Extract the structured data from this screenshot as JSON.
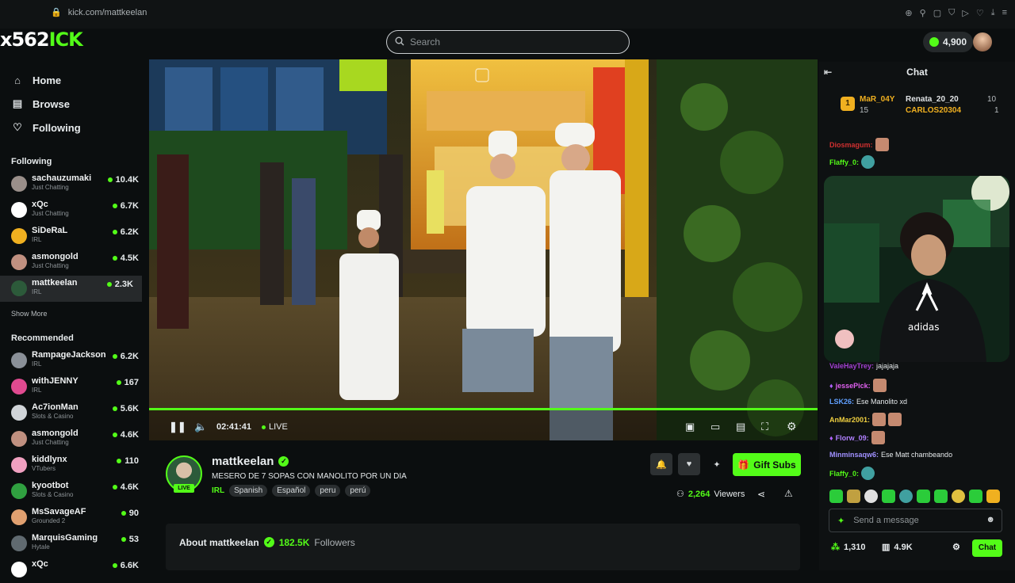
{
  "browser": {
    "url": "kick.com/mattkeelan"
  },
  "header": {
    "logo": {
      "prefix": "x562",
      "text": "ICK"
    },
    "search_placeholder": "Search",
    "coins": "4,900"
  },
  "sidebar": {
    "nav": [
      {
        "label": "Home",
        "icon": "home-icon"
      },
      {
        "label": "Browse",
        "icon": "browse-icon"
      },
      {
        "label": "Following",
        "icon": "heart-icon"
      }
    ],
    "following_title": "Following",
    "following": [
      {
        "name": "sachauzumaki",
        "category": "Just Chatting",
        "viewers": "10.4K",
        "color": "#9a8f8a"
      },
      {
        "name": "xQc",
        "category": "Just Chatting",
        "viewers": "6.7K",
        "color": "#ffffff"
      },
      {
        "name": "SiDeRaL",
        "category": "IRL",
        "viewers": "6.2K",
        "color": "#f0b020"
      },
      {
        "name": "asmongold",
        "category": "Just Chatting",
        "viewers": "4.5K",
        "color": "#c09080"
      },
      {
        "name": "mattkeelan",
        "category": "IRL",
        "viewers": "2.3K",
        "color": "#2c5a3a"
      }
    ],
    "show_more": "Show More",
    "recommended_title": "Recommended",
    "recommended": [
      {
        "name": "RampageJackson",
        "category": "IRL",
        "viewers": "6.2K",
        "color": "#8a9098"
      },
      {
        "name": "withJENNY",
        "category": "IRL",
        "viewers": "167",
        "color": "#e04a90"
      },
      {
        "name": "Ac7ionMan",
        "category": "Slots & Casino",
        "viewers": "5.6K",
        "color": "#d0d4d8"
      },
      {
        "name": "asmongold",
        "category": "Just Chatting",
        "viewers": "4.6K",
        "color": "#c09080"
      },
      {
        "name": "kiddlynx",
        "category": "VTubers",
        "viewers": "110",
        "color": "#f0a0c0"
      },
      {
        "name": "kyootbot",
        "category": "Slots & Casino",
        "viewers": "4.6K",
        "color": "#30a040"
      },
      {
        "name": "MsSavageAF",
        "category": "Grounded 2",
        "viewers": "90",
        "color": "#e0a070"
      },
      {
        "name": "MarquisGaming",
        "category": "Hytale",
        "viewers": "53",
        "color": "#606a70"
      },
      {
        "name": "xQc",
        "category": "",
        "viewers": "6.6K",
        "color": "#ffffff"
      }
    ]
  },
  "player": {
    "time": "02:41:41",
    "live_label": "LIVE"
  },
  "channel": {
    "name": "mattkeelan",
    "live_badge": "LIVE",
    "title": "MESERO DE 7 SOPAS CON MANOLITO POR UN DIA",
    "category": "IRL",
    "tags": [
      "Spanish",
      "Español",
      "peru",
      "perú"
    ],
    "gift_subs": "Gift Subs",
    "viewers": "2,264",
    "viewers_label": "Viewers",
    "about_prefix": "About mattkeelan",
    "followers_count": "182.5K",
    "followers_label": "Followers"
  },
  "chat": {
    "title": "Chat",
    "pinned": {
      "top_user": "MaR_04Y",
      "top_amount": "15",
      "second_user": "Renata_20_20",
      "second_amount": "10",
      "third_user": "CARLOS20304",
      "third_amount": "1"
    },
    "messages": [
      {
        "user": "Flaffy_0:",
        "text": "",
        "color": "#53fc18"
      },
      {
        "user": "jessePick:",
        "text": "",
        "color": "#e060f0"
      },
      {
        "user": "LSK26:",
        "text": "Ese Manolito xd",
        "color": "#60a0ff"
      },
      {
        "user": "AnMar2001:",
        "text": "",
        "color": "#f0d040"
      },
      {
        "user": "Florw_09:",
        "text": "",
        "color": "#b080ff"
      },
      {
        "user": "Minminsaqw6:",
        "text": "Ese Matt chambeando",
        "color": "#a090ff"
      },
      {
        "user": "Flaffy_0:",
        "text": "",
        "color": "#53fc18"
      }
    ],
    "partial_message": "jajajaja",
    "input_placeholder": "Send a message",
    "points": "1,310",
    "stat": "4.9K",
    "send_label": "Chat"
  }
}
